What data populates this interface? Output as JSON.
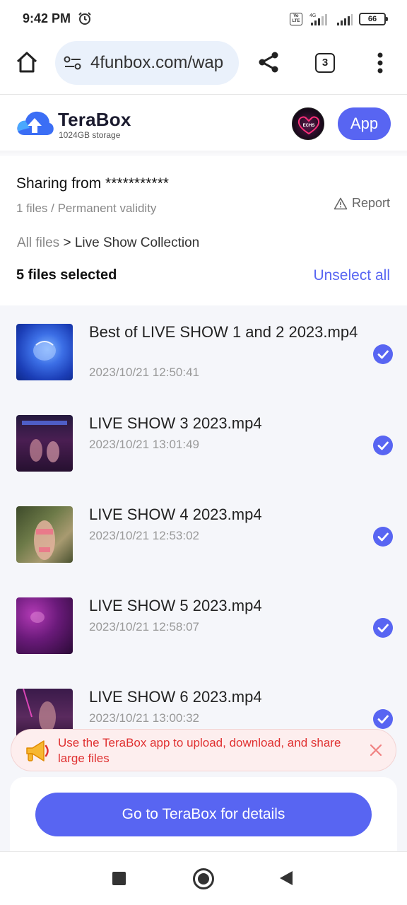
{
  "status_bar": {
    "time": "9:42 PM",
    "network": "4G",
    "battery": "66",
    "volte": "Vo LTE"
  },
  "browser": {
    "url": "4funbox.com/wap",
    "tab_count": "3"
  },
  "header": {
    "brand": "TeraBox",
    "storage": "1024GB storage",
    "app_button": "App",
    "avatar_text": "ECHS"
  },
  "share": {
    "sharing_from": "Sharing from ***********",
    "meta": "1 files / Permanent validity",
    "report": "Report",
    "breadcrumb_root": "All files",
    "breadcrumb_sep": " > ",
    "breadcrumb_current": "Live Show Collection",
    "selected_count": "5 files selected",
    "unselect_all": "Unselect all"
  },
  "files": [
    {
      "name": "Best of LIVE SHOW 1 and 2 2023.mp4",
      "date": "2023/10/21 12:50:41",
      "selected": true
    },
    {
      "name": "LIVE SHOW 3 2023.mp4",
      "date": "2023/10/21 13:01:49",
      "selected": true
    },
    {
      "name": "LIVE SHOW 4 2023.mp4",
      "date": "2023/10/21 12:53:02",
      "selected": true
    },
    {
      "name": "LIVE SHOW 5 2023.mp4",
      "date": "2023/10/21 12:58:07",
      "selected": true
    },
    {
      "name": "LIVE SHOW 6 2023.mp4",
      "date": "2023/10/21 13:00:32",
      "selected": true
    }
  ],
  "promo": {
    "text": "Use the TeraBox app to upload, download, and share large files"
  },
  "cta": {
    "label": "Go to TeraBox for details"
  },
  "colors": {
    "accent": "#5865f2",
    "promo_text": "#e03131",
    "list_bg": "#f5f6fa"
  }
}
